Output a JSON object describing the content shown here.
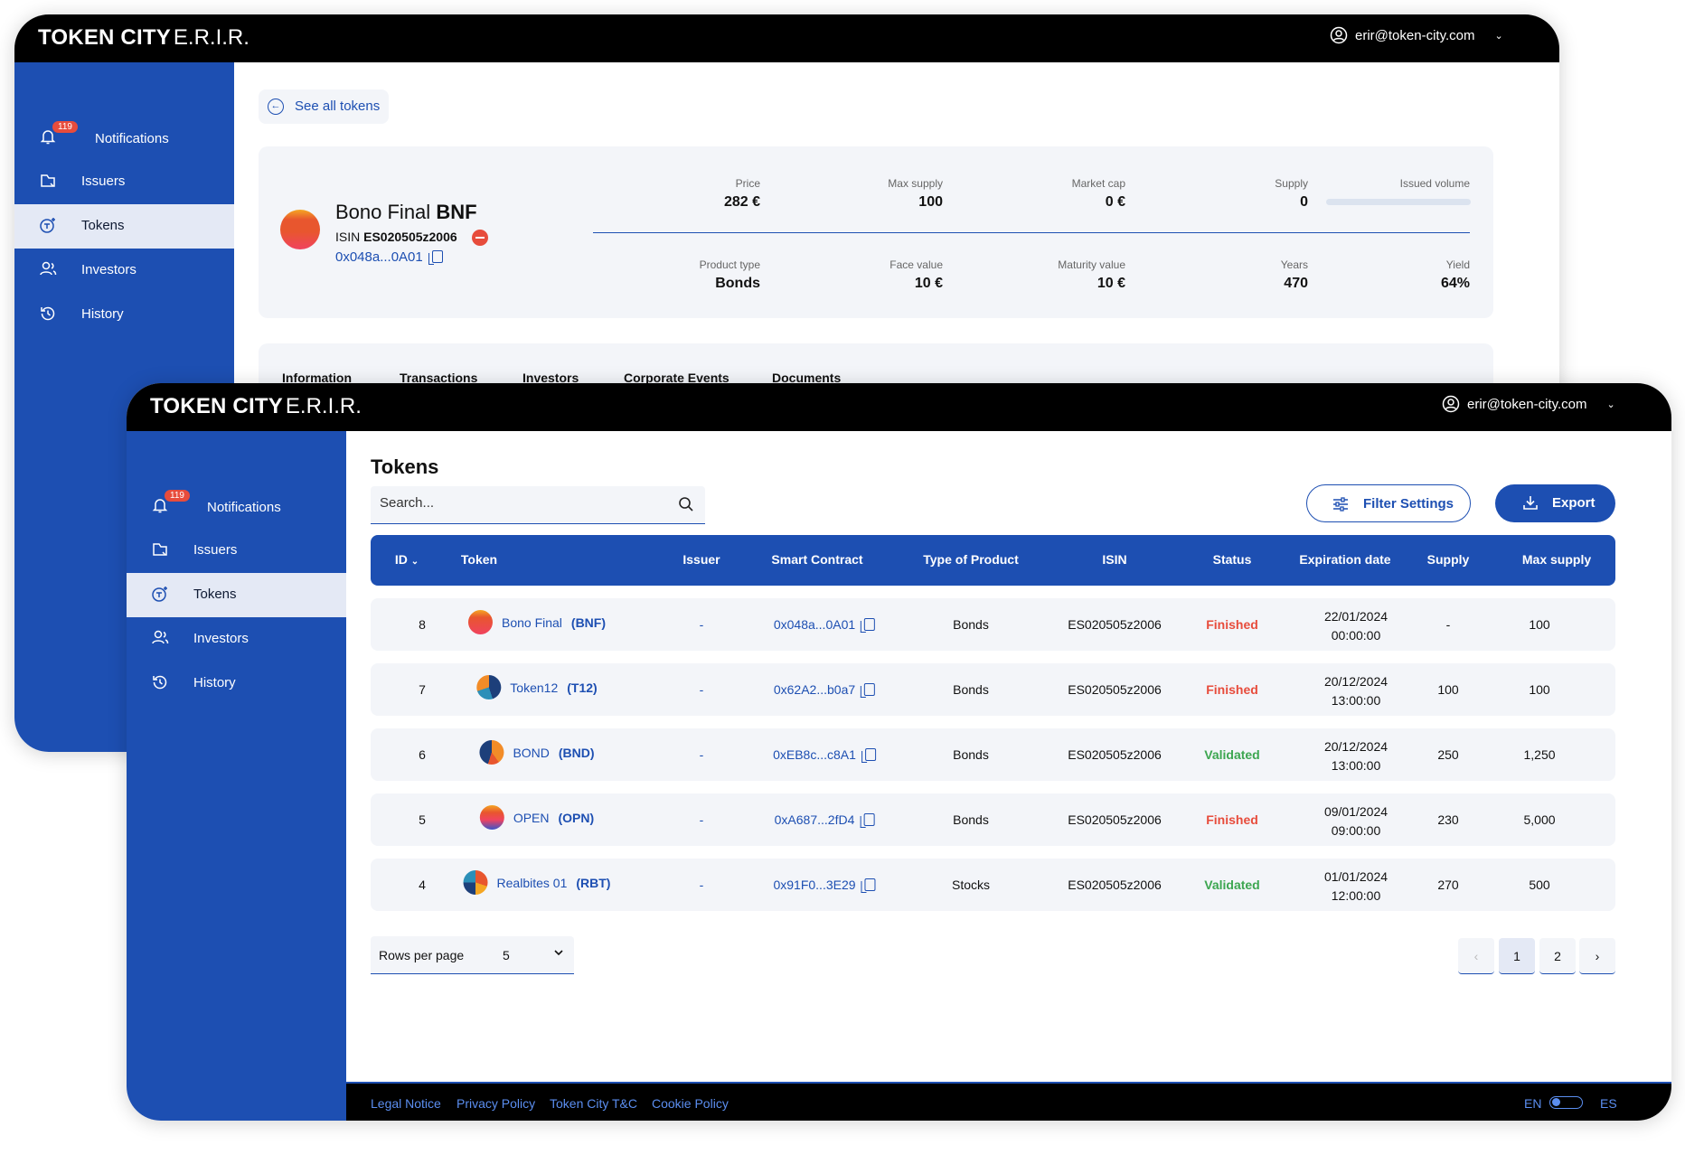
{
  "app": {
    "logo_bold": "TOKEN CITY",
    "logo_suffix": "E.R.I.R.",
    "user_email": "erir@token-city.com"
  },
  "sidebar": {
    "notification_count": "119",
    "items": [
      {
        "label": "Notifications",
        "icon": "bell-icon"
      },
      {
        "label": "Issuers",
        "icon": "issuers-icon"
      },
      {
        "label": "Tokens",
        "icon": "tokens-icon"
      },
      {
        "label": "Investors",
        "icon": "investors-icon"
      },
      {
        "label": "History",
        "icon": "history-icon"
      }
    ],
    "active": "Tokens"
  },
  "detail": {
    "back_label": "See all tokens",
    "token_name": "Bono Final",
    "token_symbol": "BNF",
    "isin_label": "ISIN",
    "isin_value": "ES020505z2006",
    "address": "0x048a...0A01",
    "metrics_top": [
      {
        "label": "Price",
        "value": "282 €"
      },
      {
        "label": "Max supply",
        "value": "100"
      },
      {
        "label": "Market cap",
        "value": "0 €"
      },
      {
        "label": "Supply",
        "value": "0"
      },
      {
        "label": "Issued volume",
        "value": ""
      }
    ],
    "metrics_bottom": [
      {
        "label": "Product type",
        "value": "Bonds"
      },
      {
        "label": "Face value",
        "value": "10 €"
      },
      {
        "label": "Maturity value",
        "value": "10 €"
      },
      {
        "label": "Years",
        "value": "470"
      },
      {
        "label": "Yield",
        "value": "64%"
      }
    ],
    "tabs": [
      "Information",
      "Transactions",
      "Investors",
      "Corporate Events",
      "Documents"
    ]
  },
  "list": {
    "title": "Tokens",
    "search_placeholder": "Search...",
    "filter_label": "Filter Settings",
    "export_label": "Export",
    "columns": [
      "ID",
      "Token",
      "Issuer",
      "Smart Contract",
      "Type of Product",
      "ISIN",
      "Status",
      "Expiration date",
      "Supply",
      "Max supply"
    ],
    "rows": [
      {
        "id": "8",
        "name": "Bono Final",
        "symbol": "(BNF)",
        "issuer": "-",
        "contract": "0x048a...0A01",
        "type": "Bonds",
        "isin": "ES020505z2006",
        "status": "Finished",
        "date": "22/01/2024",
        "time": "00:00:00",
        "supply": "-",
        "max_supply": "100"
      },
      {
        "id": "7",
        "name": "Token12",
        "symbol": "(T12)",
        "issuer": "-",
        "contract": "0x62A2...b0a7",
        "type": "Bonds",
        "isin": "ES020505z2006",
        "status": "Finished",
        "date": "20/12/2024",
        "time": "13:00:00",
        "supply": "100",
        "max_supply": "100"
      },
      {
        "id": "6",
        "name": "BOND",
        "symbol": "(BND)",
        "issuer": "-",
        "contract": "0xEB8c...c8A1",
        "type": "Bonds",
        "isin": "ES020505z2006",
        "status": "Validated",
        "date": "20/12/2024",
        "time": "13:00:00",
        "supply": "250",
        "max_supply": "1,250"
      },
      {
        "id": "5",
        "name": "OPEN",
        "symbol": "(OPN)",
        "issuer": "-",
        "contract": "0xA687...2fD4",
        "type": "Bonds",
        "isin": "ES020505z2006",
        "status": "Finished",
        "date": "09/01/2024",
        "time": "09:00:00",
        "supply": "230",
        "max_supply": "5,000"
      },
      {
        "id": "4",
        "name": "Realbites 01",
        "symbol": "(RBT)",
        "issuer": "-",
        "contract": "0x91F0...3E29",
        "type": "Stocks",
        "isin": "ES020505z2006",
        "status": "Validated",
        "date": "01/01/2024",
        "time": "12:00:00",
        "supply": "270",
        "max_supply": "500"
      }
    ],
    "rows_per_page_label": "Rows per page",
    "rows_per_page_value": "5",
    "pages": [
      "1",
      "2"
    ],
    "current_page": "1"
  },
  "footer": {
    "links": [
      "Legal Notice",
      "Privacy Policy",
      "Token City T&C",
      "Cookie Policy"
    ],
    "lang_left": "EN",
    "lang_right": "ES"
  },
  "colors": {
    "brand_blue": "#1d4fb2",
    "finished": "#e74c3c",
    "validated": "#3ca650"
  }
}
